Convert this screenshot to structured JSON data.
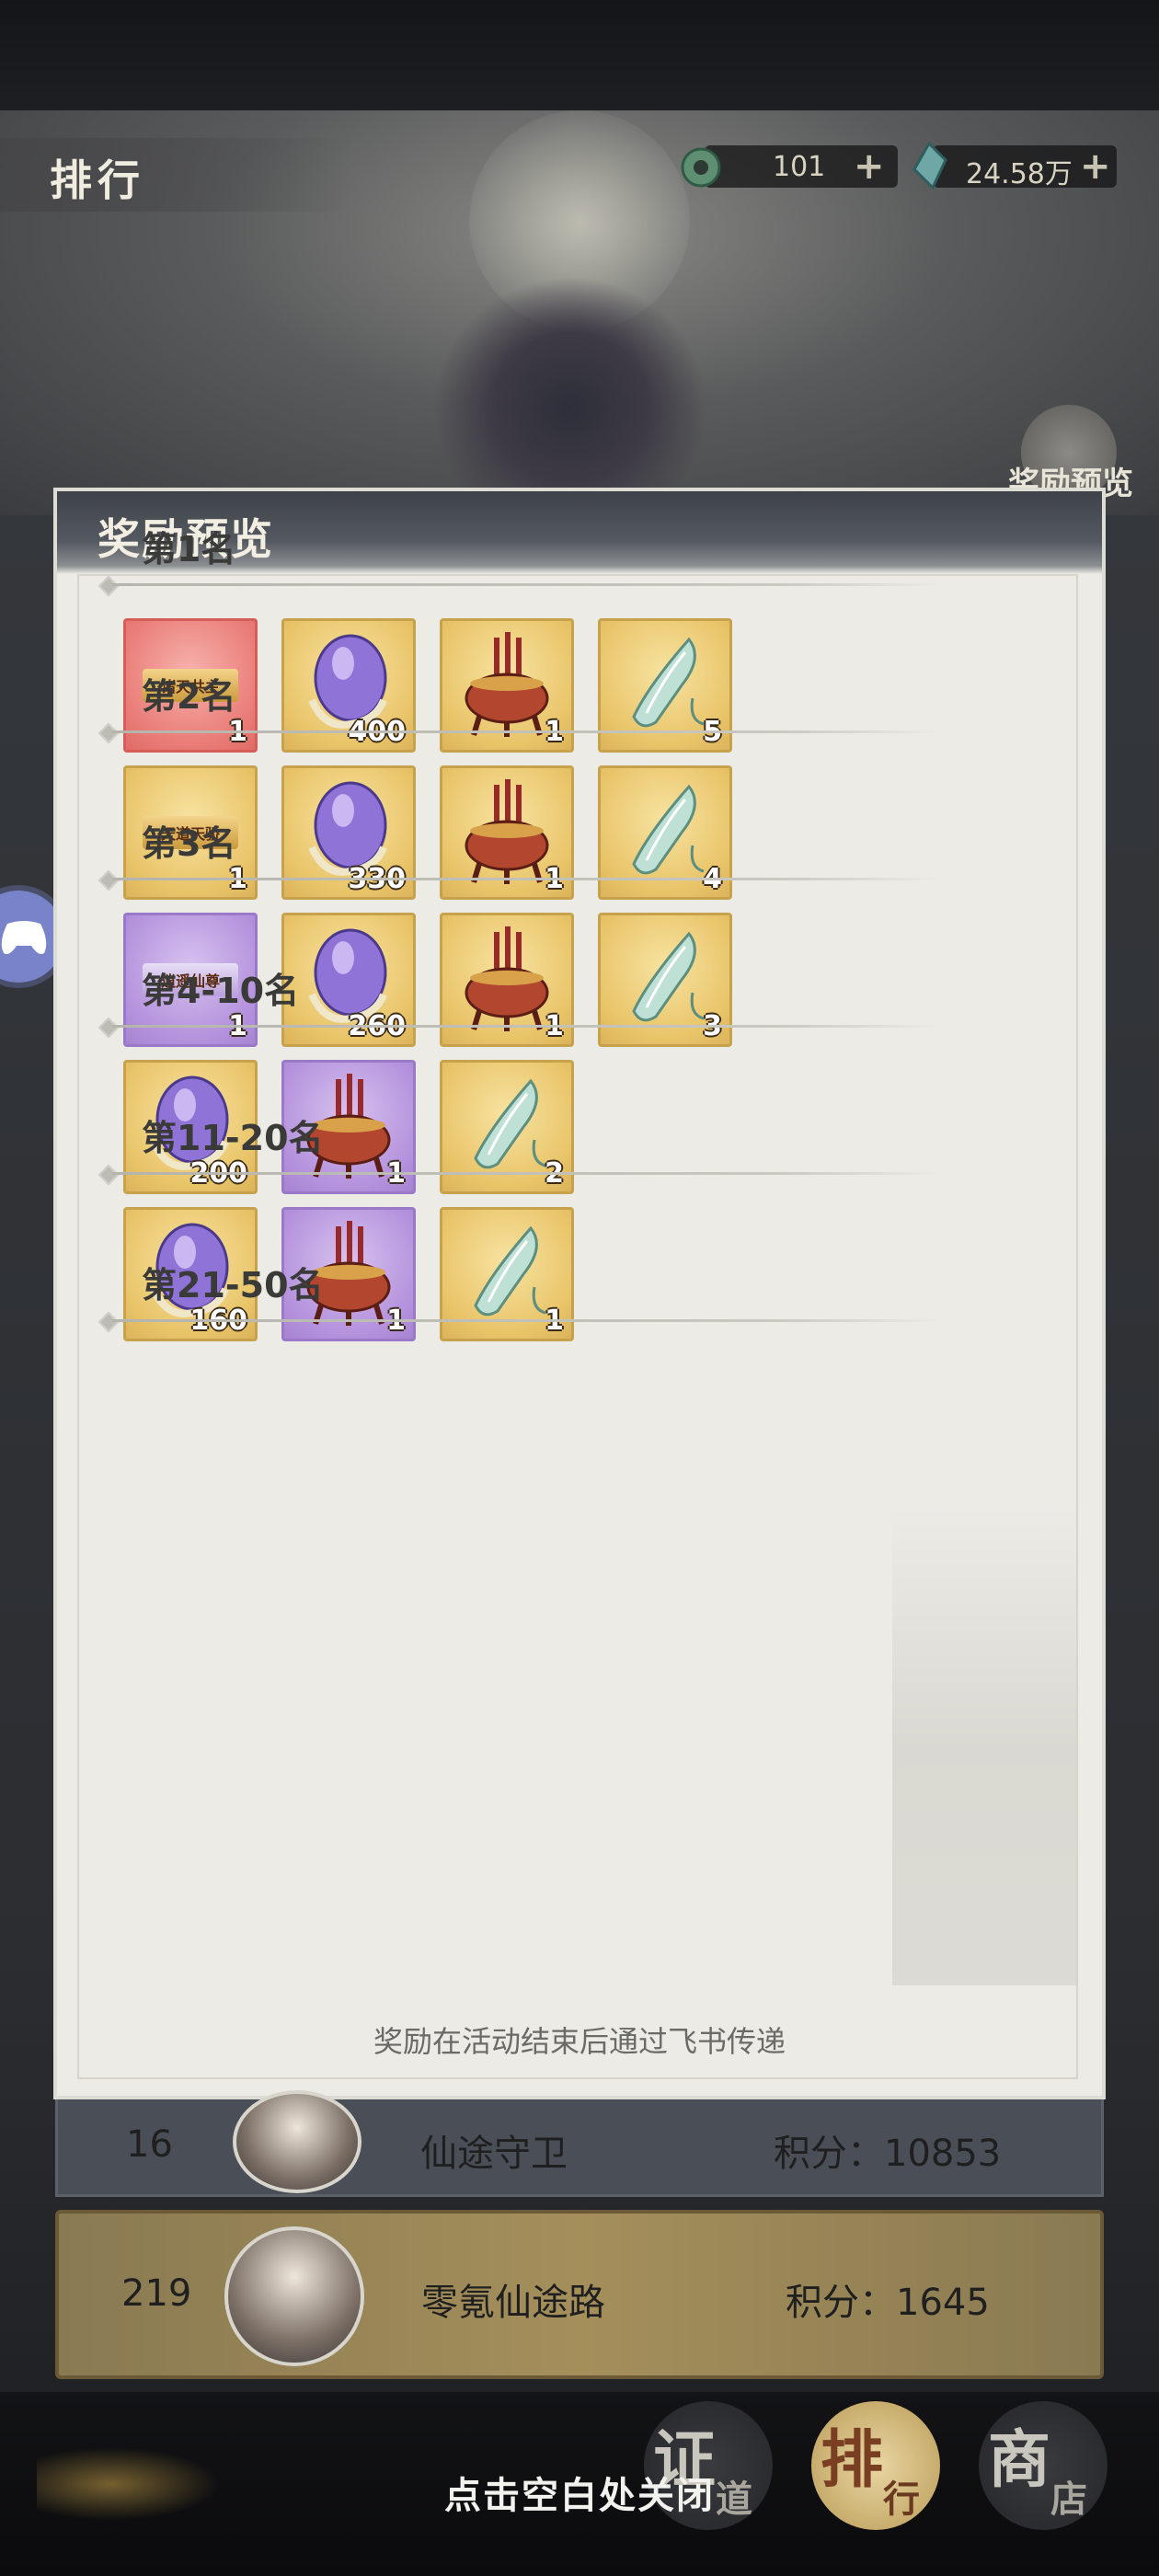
{
  "header": {
    "title": "排行",
    "currency_jade": {
      "value": "101",
      "plus": "+",
      "icon": "jade-coin-icon"
    },
    "currency_stone": {
      "value": "24.58万",
      "plus": "+",
      "icon": "spirit-stone-icon"
    }
  },
  "side_badge": {
    "label": "奖励预览",
    "icon": "reward-preview-icon"
  },
  "panel": {
    "title": "奖励预览",
    "footer": "奖励在活动结束后通过飞书传递",
    "tiers": [
      {
        "label": "第1名",
        "items": [
          {
            "kind": "title",
            "bg": "red",
            "text": "诸天共主",
            "qty": "1"
          },
          {
            "kind": "gem",
            "bg": "gold",
            "qty": "400"
          },
          {
            "kind": "incense",
            "bg": "gold",
            "qty": "1"
          },
          {
            "kind": "cicada",
            "bg": "gold",
            "qty": "5"
          }
        ]
      },
      {
        "label": "第2名",
        "items": [
          {
            "kind": "title",
            "bg": "gold",
            "text": "天道天骄",
            "qty": "1"
          },
          {
            "kind": "gem",
            "bg": "gold",
            "qty": "330"
          },
          {
            "kind": "incense",
            "bg": "gold",
            "qty": "1"
          },
          {
            "kind": "cicada",
            "bg": "gold",
            "qty": "4"
          }
        ]
      },
      {
        "label": "第3名",
        "items": [
          {
            "kind": "title",
            "bg": "purple",
            "text": "逍遥仙尊",
            "qty": "1"
          },
          {
            "kind": "gem",
            "bg": "gold",
            "qty": "260"
          },
          {
            "kind": "incense",
            "bg": "gold",
            "qty": "1"
          },
          {
            "kind": "cicada",
            "bg": "gold",
            "qty": "3"
          }
        ]
      },
      {
        "label": "第4-10名",
        "items": [
          {
            "kind": "gem",
            "bg": "gold",
            "qty": "200"
          },
          {
            "kind": "incense",
            "bg": "purple",
            "qty": "1"
          },
          {
            "kind": "cicada",
            "bg": "gold",
            "qty": "2"
          }
        ]
      },
      {
        "label": "第11-20名",
        "items": [
          {
            "kind": "gem",
            "bg": "gold",
            "qty": "160"
          },
          {
            "kind": "incense",
            "bg": "purple",
            "qty": "1"
          },
          {
            "kind": "cicada",
            "bg": "gold",
            "qty": "1"
          }
        ]
      },
      {
        "label": "第21-50名",
        "items": []
      }
    ]
  },
  "ranking": {
    "row": {
      "rank": "16",
      "name": "仙途守卫",
      "score": "积分：10853"
    },
    "mine": {
      "rank": "219",
      "name": "零氪仙途路",
      "score": "积分：1645"
    }
  },
  "bottom": {
    "close_hint": "点击空白处关闭",
    "nav": [
      {
        "main": "证",
        "sub": "道"
      },
      {
        "main": "排",
        "sub": "行"
      },
      {
        "main": "商",
        "sub": "店"
      }
    ]
  },
  "colors": {
    "panel_bg": "#ecebe6",
    "item_gold": "#e9c56a",
    "item_red": "#ea7d78",
    "item_purple": "#b593dd",
    "my_row": "#a48f5b"
  }
}
